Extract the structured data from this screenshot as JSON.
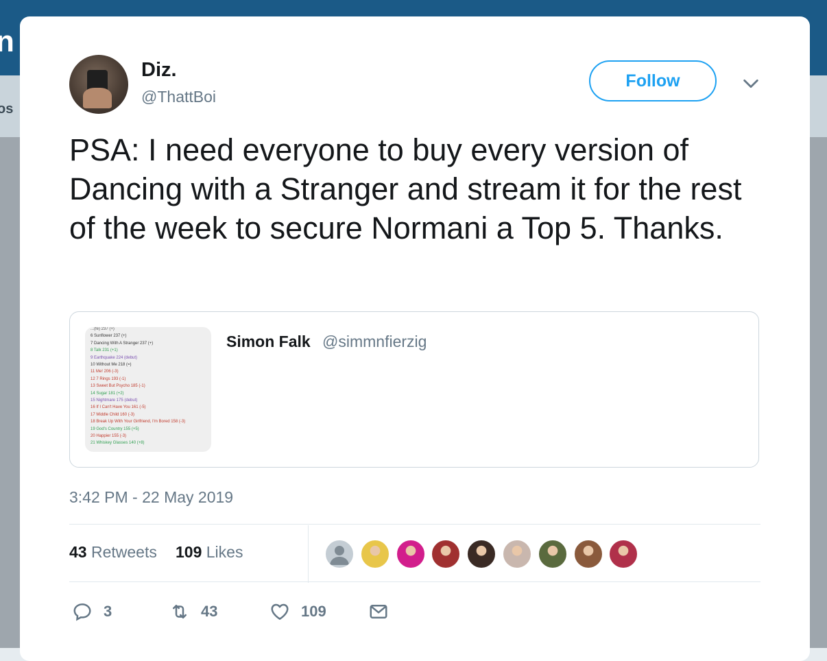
{
  "background": {
    "topbar_edge_text": "n",
    "subbar_edge_text": "os"
  },
  "tweet": {
    "author_name": "Diz.",
    "author_handle": "@ThattBoi",
    "follow_label": "Follow",
    "text": "PSA: I need everyone to buy every version of Dancing with a Stranger and stream it for the rest of the week to secure Normani a Top 5. Thanks.",
    "timestamp": "3:42 PM - 22 May 2019"
  },
  "quoted_tweet": {
    "author_name": "Simon Falk",
    "author_handle": "@simmnfierzig",
    "image_lines": [
      {
        "text": "...(fe) 237 (+)",
        "color": "#555555"
      },
      {
        "text": "6 Sunflower 237 (+)",
        "color": "#333333"
      },
      {
        "text": "7 Dancing With A Stranger      237  (+)",
        "color": "#333333"
      },
      {
        "text": "8 Talk      231  (+1)",
        "color": "#2e9e4f"
      },
      {
        "text": "9 Earthquake      224  (debut)",
        "color": "#7a4fb0"
      },
      {
        "text": "10 Without Me      218  (=)",
        "color": "#333333"
      },
      {
        "text": "11 Me!      206  (-3)",
        "color": "#c0392b"
      },
      {
        "text": "12 7 Rings      193 (-1)",
        "color": "#c0392b"
      },
      {
        "text": "13 Sweet But Psycho      185  (-1)",
        "color": "#c0392b"
      },
      {
        "text": "14 Sugar      181  (+2)",
        "color": "#2e9e4f"
      },
      {
        "text": "15 Nightmare      175  (debut)",
        "color": "#7a4fb0"
      },
      {
        "text": "16 If I Can't Have You      161  (-5)",
        "color": "#c0392b"
      },
      {
        "text": "17 Middle Child      160  (-3)",
        "color": "#c0392b"
      },
      {
        "text": "18 Break Up With Your Girlfriend, I'm Bored      158  (-3)",
        "color": "#c0392b"
      },
      {
        "text": "19 God's Country      155  (+5)",
        "color": "#2e9e4f"
      },
      {
        "text": "20 Happier      155  (-3)",
        "color": "#c0392b"
      },
      {
        "text": "21 Whiskey Glasses      140  (+8)",
        "color": "#2e9e4f"
      }
    ]
  },
  "stats": {
    "retweets_count": "43",
    "retweets_label": "Retweets",
    "likes_count": "109",
    "likes_label": "Likes"
  },
  "likers": [
    {
      "icon": "default-avatar",
      "color": "#c4cdd4"
    },
    {
      "icon": "avatar",
      "color": "#e8c64a"
    },
    {
      "icon": "avatar",
      "color": "#d21e8c"
    },
    {
      "icon": "avatar",
      "color": "#a03030"
    },
    {
      "icon": "avatar",
      "color": "#3a2a24"
    },
    {
      "icon": "avatar",
      "color": "#c9b7ae"
    },
    {
      "icon": "avatar",
      "color": "#5a6a3e"
    },
    {
      "icon": "avatar",
      "color": "#8a5a3c"
    },
    {
      "icon": "avatar",
      "color": "#b0304a"
    }
  ],
  "actions": {
    "reply_count": "3",
    "retweet_count": "43",
    "like_count": "109"
  },
  "colors": {
    "accent": "#1da1f2",
    "secondary_text": "#657786",
    "topbar": "#1b5a87"
  }
}
